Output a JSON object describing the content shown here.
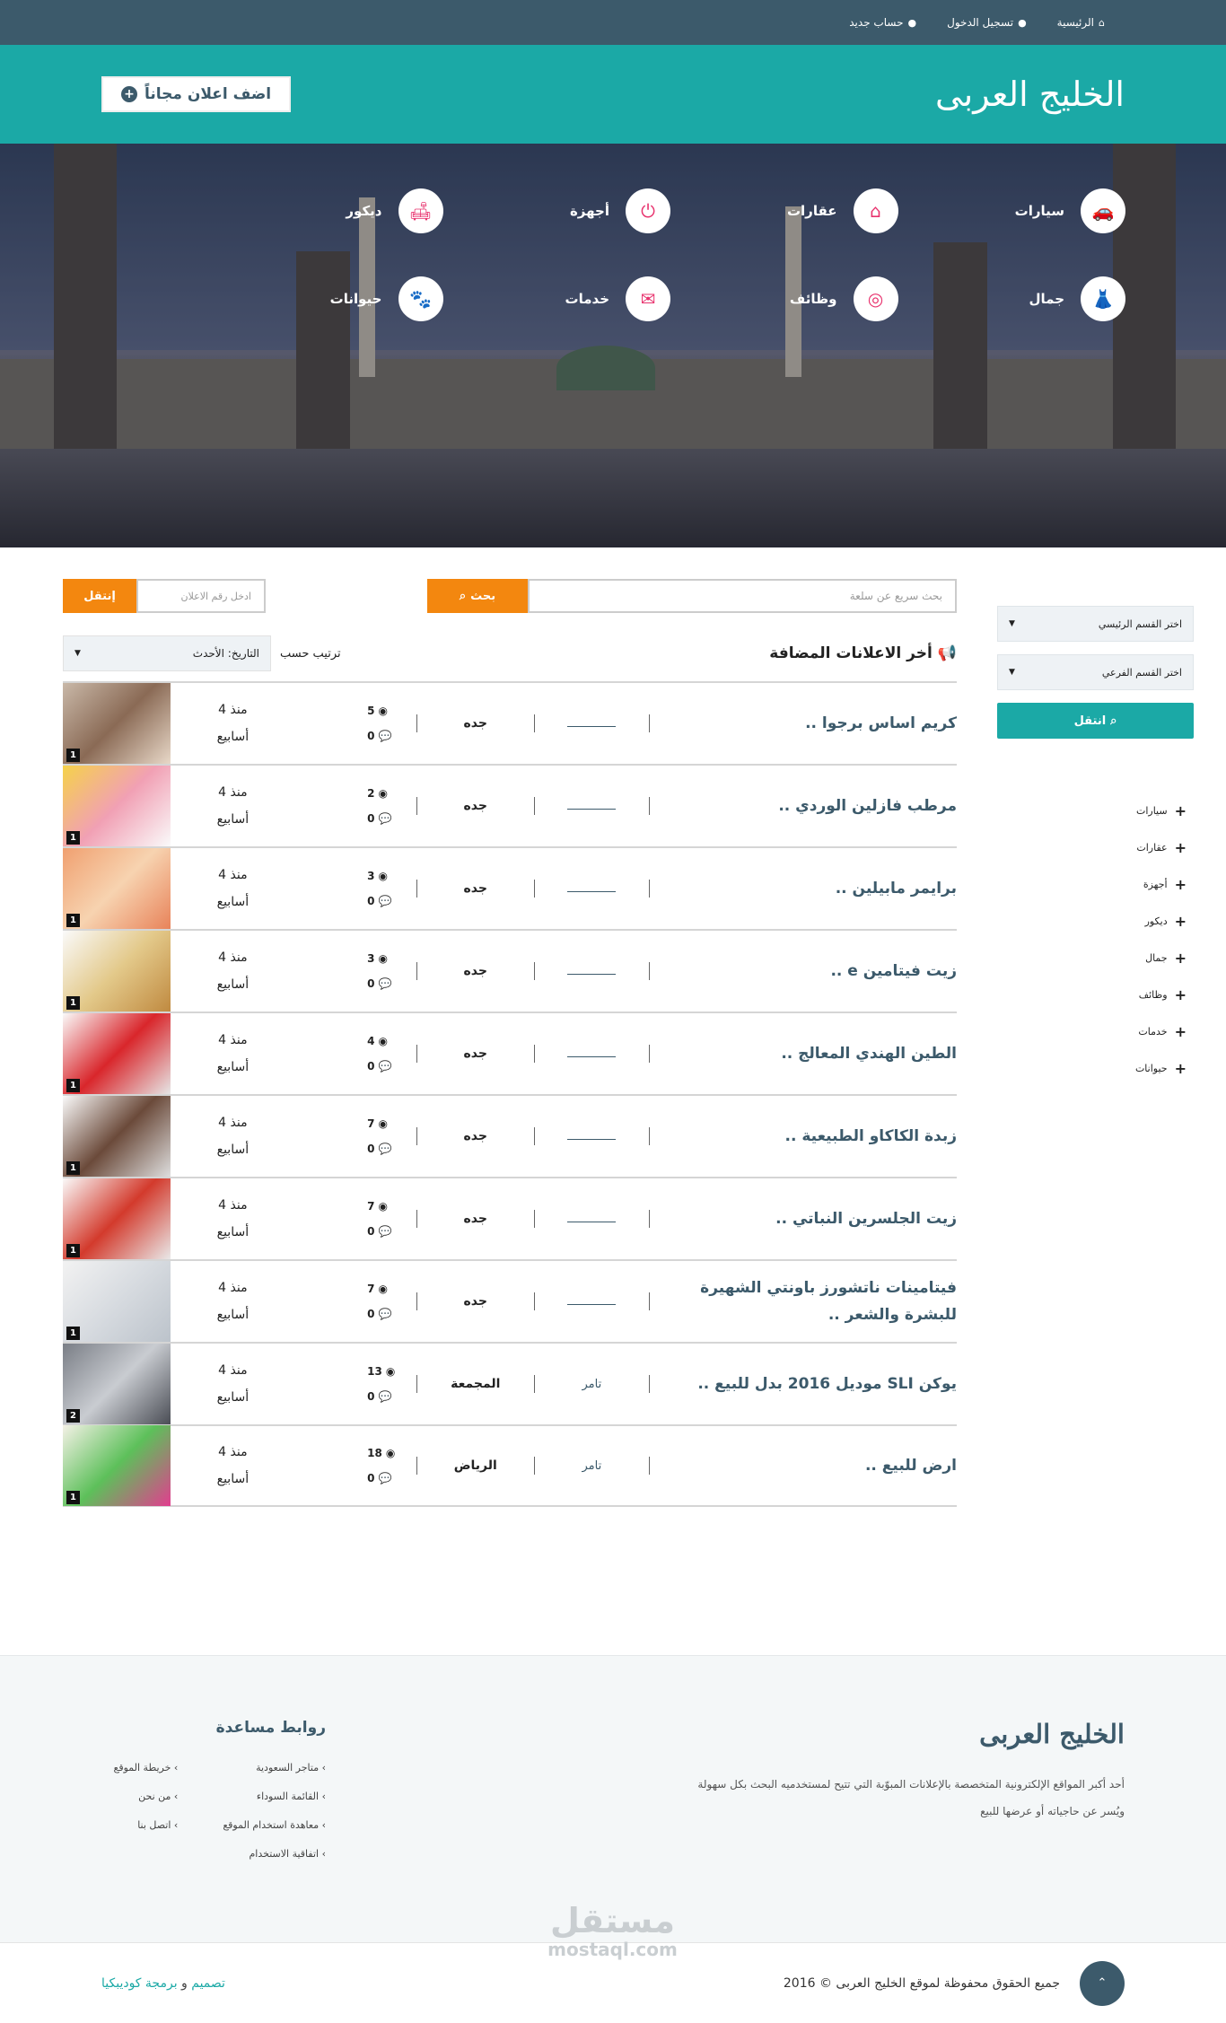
{
  "topbar": {
    "home": "الرئيسية",
    "login": "تسجيل الدخول",
    "register": "حساب جديد"
  },
  "header": {
    "logo": "الخليج العربى",
    "add_button": "اضف اعلان مجاناً"
  },
  "categories": [
    {
      "label": "سيارات",
      "icon": "car-icon",
      "glyph": "🚗"
    },
    {
      "label": "عقارات",
      "icon": "home-icon",
      "glyph": "⌂"
    },
    {
      "label": "أجهزة",
      "icon": "plug-icon",
      "glyph": "⏻"
    },
    {
      "label": "ديكور",
      "icon": "sofa-icon",
      "glyph": "🛋"
    },
    {
      "label": "جمال",
      "icon": "dress-icon",
      "glyph": "👗"
    },
    {
      "label": "وظائف",
      "icon": "briefcase-icon",
      "glyph": "◎"
    },
    {
      "label": "خدمات",
      "icon": "envelope-icon",
      "glyph": "✉"
    },
    {
      "label": "حيوانات",
      "icon": "paw-icon",
      "glyph": "🐾"
    }
  ],
  "search": {
    "placeholder": "بحث سريع عن سلعة",
    "button": "بحث",
    "ad_number_placeholder": "ادخل رقم الاعلان",
    "move_button": "إنتقل"
  },
  "list": {
    "title": "أخر الاعلانات المضافة",
    "sort_label": "ترتيب حسب",
    "sort_value": "التاريخ: الأحدث"
  },
  "sidebar": {
    "main_select": "اختر القسم الرئيسي",
    "sub_select": "اختر القسم الفرعي",
    "go_button": "انتقل",
    "items": [
      "سيارات",
      "عقارات",
      "أجهزة",
      "ديكور",
      "جمال",
      "وظائف",
      "خدمات",
      "حيوانات"
    ]
  },
  "ads": [
    {
      "title": "كريم اساس برجوا ..",
      "owner": "",
      "city": "جده",
      "views": "5",
      "comments": "0",
      "time1": "منذ 4",
      "time2": "أسابيع",
      "img_count": "1",
      "img_colors": [
        "#c9b8a8",
        "#8a6a55",
        "#e8d8c8"
      ]
    },
    {
      "title": "مرطب فازلين الوردي ..",
      "owner": "",
      "city": "جده",
      "views": "2",
      "comments": "0",
      "time1": "منذ 4",
      "time2": "أسابيع",
      "img_count": "1",
      "img_colors": [
        "#f5d24a",
        "#f1a0b4",
        "#fafafa"
      ]
    },
    {
      "title": "برايمر مابيلين ..",
      "owner": "",
      "city": "جده",
      "views": "3",
      "comments": "0",
      "time1": "منذ 4",
      "time2": "أسابيع",
      "img_count": "1",
      "img_colors": [
        "#f0a070",
        "#f7d3b0",
        "#e8835a"
      ]
    },
    {
      "title": "زيت فيتامين e ..",
      "owner": "",
      "city": "جده",
      "views": "3",
      "comments": "0",
      "time1": "منذ 4",
      "time2": "أسابيع",
      "img_count": "1",
      "img_colors": [
        "#fafafa",
        "#e3c98a",
        "#c08a40"
      ]
    },
    {
      "title": "الطين الهندي المعالج ..",
      "owner": "",
      "city": "جده",
      "views": "4",
      "comments": "0",
      "time1": "منذ 4",
      "time2": "أسابيع",
      "img_count": "1",
      "img_colors": [
        "#fafafa",
        "#d9262b",
        "#e6e6e6"
      ]
    },
    {
      "title": "زبدة الكاكاو الطبيعية ..",
      "owner": "",
      "city": "جده",
      "views": "7",
      "comments": "0",
      "time1": "منذ 4",
      "time2": "أسابيع",
      "img_count": "1",
      "img_colors": [
        "#fafafa",
        "#6b4a3a",
        "#dedede"
      ]
    },
    {
      "title": "زيت الجلسرين النباتي ..",
      "owner": "",
      "city": "جده",
      "views": "7",
      "comments": "0",
      "time1": "منذ 4",
      "time2": "أسابيع",
      "img_count": "1",
      "img_colors": [
        "#fafafa",
        "#d33a2c",
        "#e9e9e9"
      ]
    },
    {
      "title": "فيتامينات ناتشورز باونتي الشهيرة للبشرة والشعر ..",
      "owner": "",
      "city": "جده",
      "views": "7",
      "comments": "0",
      "time1": "منذ 4",
      "time2": "أسابيع",
      "img_count": "1",
      "img_colors": [
        "#f2f2f2",
        "#d7dbe0",
        "#bcc3cb"
      ]
    },
    {
      "title": "يوكن SLI موديل 2016 بدل للبيع ..",
      "owner": "تامر",
      "city": "المجمعة",
      "views": "13",
      "comments": "0",
      "time1": "منذ 4",
      "time2": "أسابيع",
      "img_count": "2",
      "img_colors": [
        "#7a7e86",
        "#c9ccd1",
        "#4a4d55"
      ]
    },
    {
      "title": "ارض للبيع ..",
      "owner": "تامر",
      "city": "الرياض",
      "views": "18",
      "comments": "0",
      "time1": "منذ 4",
      "time2": "أسابيع",
      "img_count": "1",
      "img_colors": [
        "#f4f1e6",
        "#5dc05a",
        "#e23d8f"
      ]
    }
  ],
  "footer": {
    "logo": "الخليج العربى",
    "desc1": "أحد أكبر المواقع الإلكترونية المتخصصة بالإعلانات المبوّبة التي تتيح لمستخدميه البحث بكل سهولة",
    "desc2": "ويُسر عن حاجياته أو عرضها للبيع",
    "links_title": "روابط مساعدة",
    "links_col1": [
      "متاجر السعودية",
      "القائمة السوداء",
      "معاهدة استخدام الموقع",
      "اتفاقية الاستخدام"
    ],
    "links_col2": [
      "خريطة الموقع",
      "من نحن",
      "اتصل بنا"
    ],
    "watermark1": "مستقل",
    "watermark2": "mostaql.com",
    "copyright": "جميع الحقوق محفوظة لموقع الخليج العربى © 2016",
    "credit_design": "تصميم",
    "credit_and": "و",
    "credit_prog": "برمجة كوديبكيا"
  },
  "colors": {
    "brand": "#1ba9a6",
    "dark": "#3c5a6b",
    "accent": "#f3870f",
    "category_icon": "#e8336e"
  }
}
